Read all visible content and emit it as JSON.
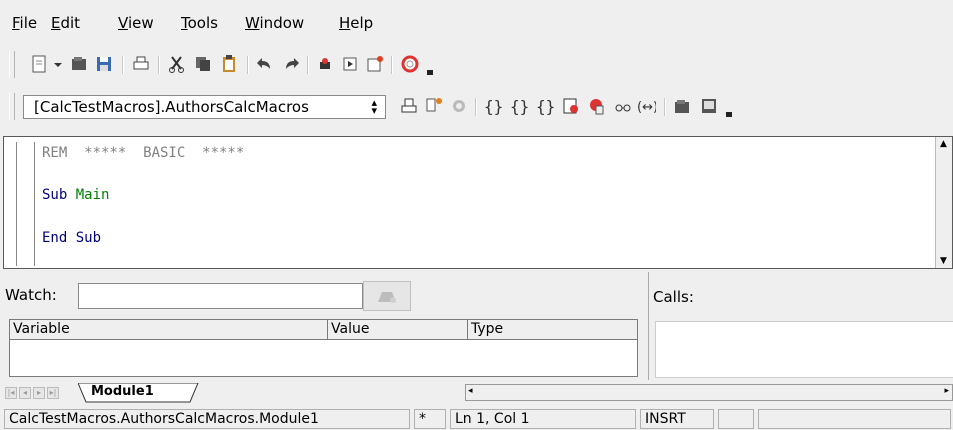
{
  "menu": {
    "items": [
      {
        "label": "File",
        "mnemonic": "F",
        "rest": "ile"
      },
      {
        "label": "Edit",
        "mnemonic": "E",
        "rest": "dit"
      },
      {
        "label": "View",
        "mnemonic": "V",
        "rest": "iew"
      },
      {
        "label": "Tools",
        "mnemonic": "T",
        "rest": "ools"
      },
      {
        "label": "Window",
        "mnemonic": "W",
        "rest": "indow"
      },
      {
        "label": "Help",
        "mnemonic": "H",
        "rest": "elp"
      }
    ]
  },
  "standard_toolbar": {
    "icons": [
      "new-document-icon",
      "dropdown-arrow-icon",
      "open-icon",
      "save-icon",
      "print-icon",
      "cut-icon",
      "copy-icon",
      "paste-icon",
      "undo-icon",
      "redo-icon",
      "navigator-icon",
      "gallery-icon",
      "edit-file-icon",
      "help-icon"
    ]
  },
  "macro_toolbar": {
    "library_selector": "[CalcTestMacros].AuthorsCalcMacros",
    "icons": [
      "compile-icon",
      "run-icon",
      "stop-icon",
      "step-into-icon",
      "step-over-icon",
      "step-out-icon",
      "breakpoint-icon",
      "manage-breakpoints-icon",
      "watch-icon",
      "find-parentheses-icon",
      "insert-basic-source-icon",
      "save-basic-icon"
    ]
  },
  "editor": {
    "lines": [
      {
        "text": "REM  *****  BASIC  *****",
        "color": "#808080"
      },
      {
        "keyword": "Sub",
        "rest": " Main",
        "color": "#000080",
        "rest_color": "#008000"
      },
      {
        "keyword": "End Sub",
        "rest": "",
        "color": "#000080",
        "rest_color": "#008000"
      }
    ]
  },
  "watch": {
    "label": "Watch:",
    "input_value": "",
    "columns": [
      "Variable",
      "Value",
      "Type"
    ]
  },
  "calls": {
    "label": "Calls:"
  },
  "tabs": {
    "module": "Module1"
  },
  "status": {
    "location": "CalcTestMacros.AuthorsCalcMacros.Module1",
    "modified": "*",
    "cursor": "Ln 1, Col 1",
    "mode": "INSRT"
  }
}
